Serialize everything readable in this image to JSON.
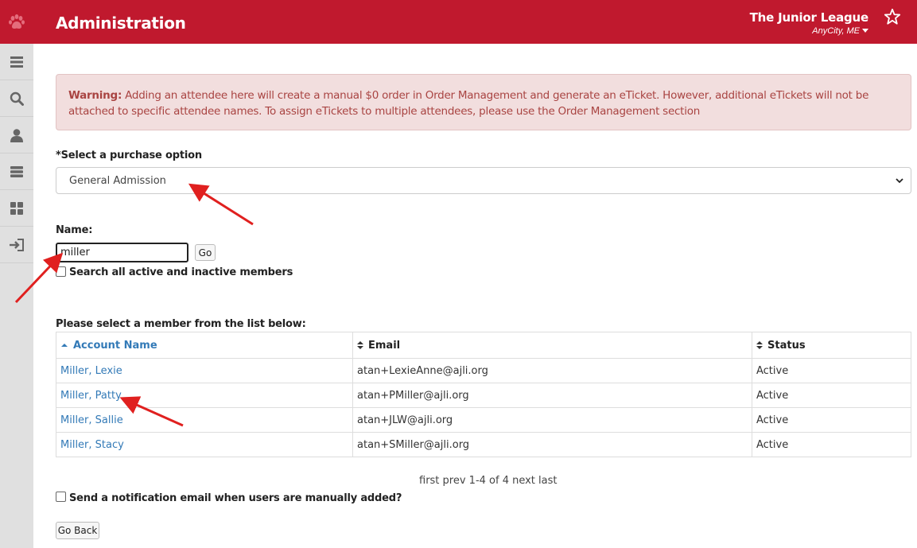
{
  "header": {
    "title": "Administration",
    "org_name": "The Junior League",
    "org_city": "AnyCity, ME"
  },
  "warning": {
    "label": "Warning:",
    "text": " Adding an attendee here will create a manual $0 order in Order Management and generate an eTicket. However, additional eTickets will not be attached to specific attendee names. To assign eTickets to multiple attendees, please use the Order Management section"
  },
  "purchase": {
    "label": "*Select a purchase option",
    "selected": "General Admission"
  },
  "name_search": {
    "label": "Name:",
    "value": "miller",
    "go_label": "Go",
    "checkbox_label": "Search all active and inactive members"
  },
  "table": {
    "title": "Please select a member from the list below:",
    "columns": [
      "Account Name",
      "Email",
      "Status"
    ],
    "rows": [
      {
        "name": "Miller, Lexie",
        "email": "atan+LexieAnne@ajli.org",
        "status": "Active"
      },
      {
        "name": "Miller, Patty",
        "email": "atan+PMiller@ajli.org",
        "status": "Active"
      },
      {
        "name": "Miller, Sallie",
        "email": "atan+JLW@ajli.org",
        "status": "Active"
      },
      {
        "name": "Miller, Stacy",
        "email": "atan+SMiller@ajli.org",
        "status": "Active"
      }
    ]
  },
  "pager": "first prev 1-4 of 4 next last",
  "notify_label": "Send a notification email when users are manually added?",
  "go_back_label": "Go Back",
  "colors": {
    "brand": "#c0192e",
    "link": "#337ab7",
    "warning_bg": "#f2dede",
    "warning_text": "#a94442",
    "annotation": "#e0201f"
  },
  "icons": {
    "logo": "paw-icon",
    "star": "star-icon",
    "sidebar": [
      "menu-icon",
      "search-icon",
      "user-icon",
      "server-icon",
      "dashboard-icon",
      "logout-icon"
    ]
  }
}
